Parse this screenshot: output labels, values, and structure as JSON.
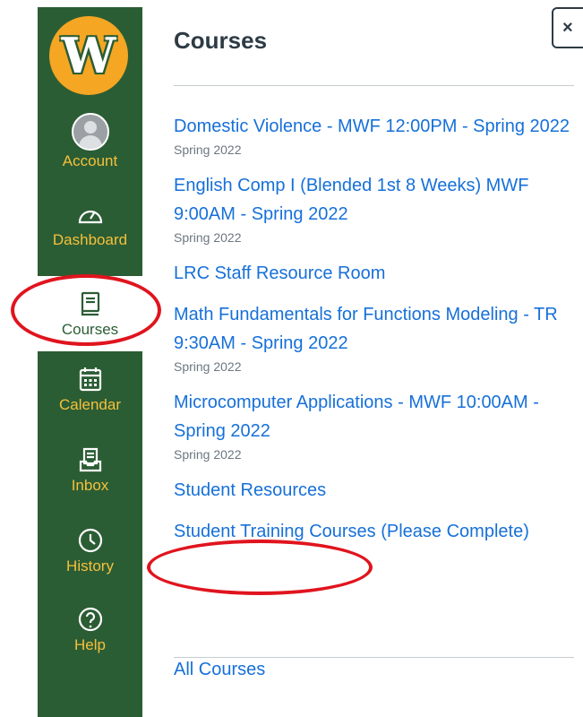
{
  "nav": {
    "logo_letter": "W",
    "items": [
      {
        "label": "Account",
        "icon": "avatar"
      },
      {
        "label": "Dashboard",
        "icon": "dashboard-icon"
      },
      {
        "label": "Courses",
        "icon": "courses-icon"
      },
      {
        "label": "Calendar",
        "icon": "calendar-icon"
      },
      {
        "label": "Inbox",
        "icon": "inbox-icon"
      },
      {
        "label": "History",
        "icon": "history-icon"
      },
      {
        "label": "Help",
        "icon": "help-icon"
      }
    ]
  },
  "tray": {
    "title": "Courses",
    "close_label": "×",
    "courses": [
      {
        "name": "Domestic Violence - MWF 12:00PM - Spring 2022",
        "term": "Spring 2022"
      },
      {
        "name": "English Comp I (Blended 1st 8 Weeks) MWF 9:00AM - Spring 2022",
        "term": "Spring 2022"
      },
      {
        "name": "LRC Staff Resource Room",
        "term": ""
      },
      {
        "name": "Math Fundamentals for Functions Modeling - TR 9:30AM - Spring 2022",
        "term": "Spring 2022"
      },
      {
        "name": "Microcomputer Applications - MWF 10:00AM - Spring 2022",
        "term": "Spring 2022"
      },
      {
        "name": "Student Resources",
        "term": ""
      },
      {
        "name": "Student Training Courses (Please Complete)",
        "term": ""
      }
    ],
    "all_courses_label": "All Courses"
  },
  "colors": {
    "nav_bg": "#2b5d34",
    "nav_text": "#f5c03b",
    "logo_bg": "#f5a623",
    "link": "#1670d9",
    "annotation": "#e0141e"
  }
}
